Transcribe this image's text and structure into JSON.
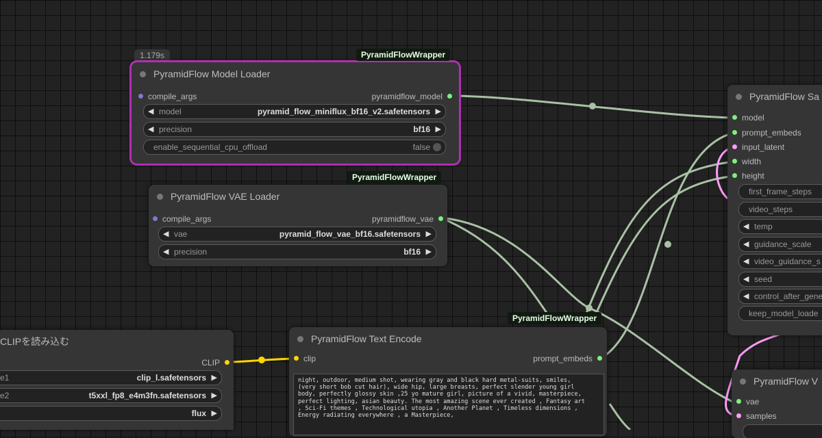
{
  "colors": {
    "canvas": "#222222",
    "node_bg": "#353535",
    "selection": "#b02fb3",
    "wire_generic": "#a9c1a5",
    "wire_clip": "#ffd500",
    "wire_latent": "#ff9cf9",
    "badge_bg": "#101a10"
  },
  "icons": {
    "node_title_dot": "circle-dot",
    "input_slot": "circle-dot",
    "output_slot": "circle-dot",
    "combo_prev": "triangle-left",
    "combo_next": "triangle-right",
    "toggle": "round-toggle"
  },
  "model_loader": {
    "timer": "1.179s",
    "badge": "PyramidFlowWrapper",
    "title": "PyramidFlow Model Loader",
    "inputs": [
      "compile_args"
    ],
    "output": "pyramidflow_model",
    "widgets": [
      {
        "label": "model",
        "value": "pyramid_flow_miniflux_bf16_v2.safetensors"
      },
      {
        "label": "precision",
        "value": "bf16"
      }
    ],
    "toggle": {
      "label": "enable_sequential_cpu_offload",
      "value": "false"
    }
  },
  "vae_loader": {
    "badge": "PyramidFlowWrapper",
    "title": "PyramidFlow VAE Loader",
    "input": "compile_args",
    "output": "pyramidflow_vae",
    "widgets": [
      {
        "label": "vae",
        "value": "pyramid_flow_vae_bf16.safetensors"
      },
      {
        "label": "precision",
        "value": "bf16"
      }
    ]
  },
  "clip_loader": {
    "title": "CLIPを読み込む",
    "output": "CLIP",
    "widgets": [
      {
        "label": "e1",
        "value": "clip_l.safetensors"
      },
      {
        "label": "e2",
        "value": "t5xxl_fp8_e4m3fn.safetensors"
      },
      {
        "label": "",
        "value": "flux"
      }
    ]
  },
  "text_encode": {
    "badge": "PyramidFlowWrapper",
    "title": "PyramidFlow Text Encode",
    "input": "clip",
    "output": "prompt_embeds",
    "prompt": "night, outdoor, medium shot, wearing gray and black hard metal-suits, smiles,\n(very short bob cut hair), wide hip, large breasts, perfect slender young girl\nbody, perfectly glossy skin ,25 yo mature girl, picture of a vivid, masterpiece,\nperfect lighting, asian beauty. The most amazing scene ever created , Fantasy art\n, Sci-Fi themes , Technological utopia , Another Planet , Timeless dimensions ,\nEnergy radiating everywhere , a Masterpiece,"
  },
  "sampler": {
    "title": "PyramidFlow Sa",
    "inputs": [
      "model",
      "prompt_embeds",
      "input_latent",
      "width",
      "height"
    ],
    "plain_widgets": [
      "first_frame_steps",
      "video_steps"
    ],
    "arrow_widgets": [
      "temp",
      "guidance_scale",
      "video_guidance_s",
      "seed",
      "control_after_gene"
    ],
    "last_widget": "keep_model_loade"
  },
  "vae_decode": {
    "title": "PyramidFlow V",
    "inputs": [
      "vae",
      "samples"
    ]
  }
}
